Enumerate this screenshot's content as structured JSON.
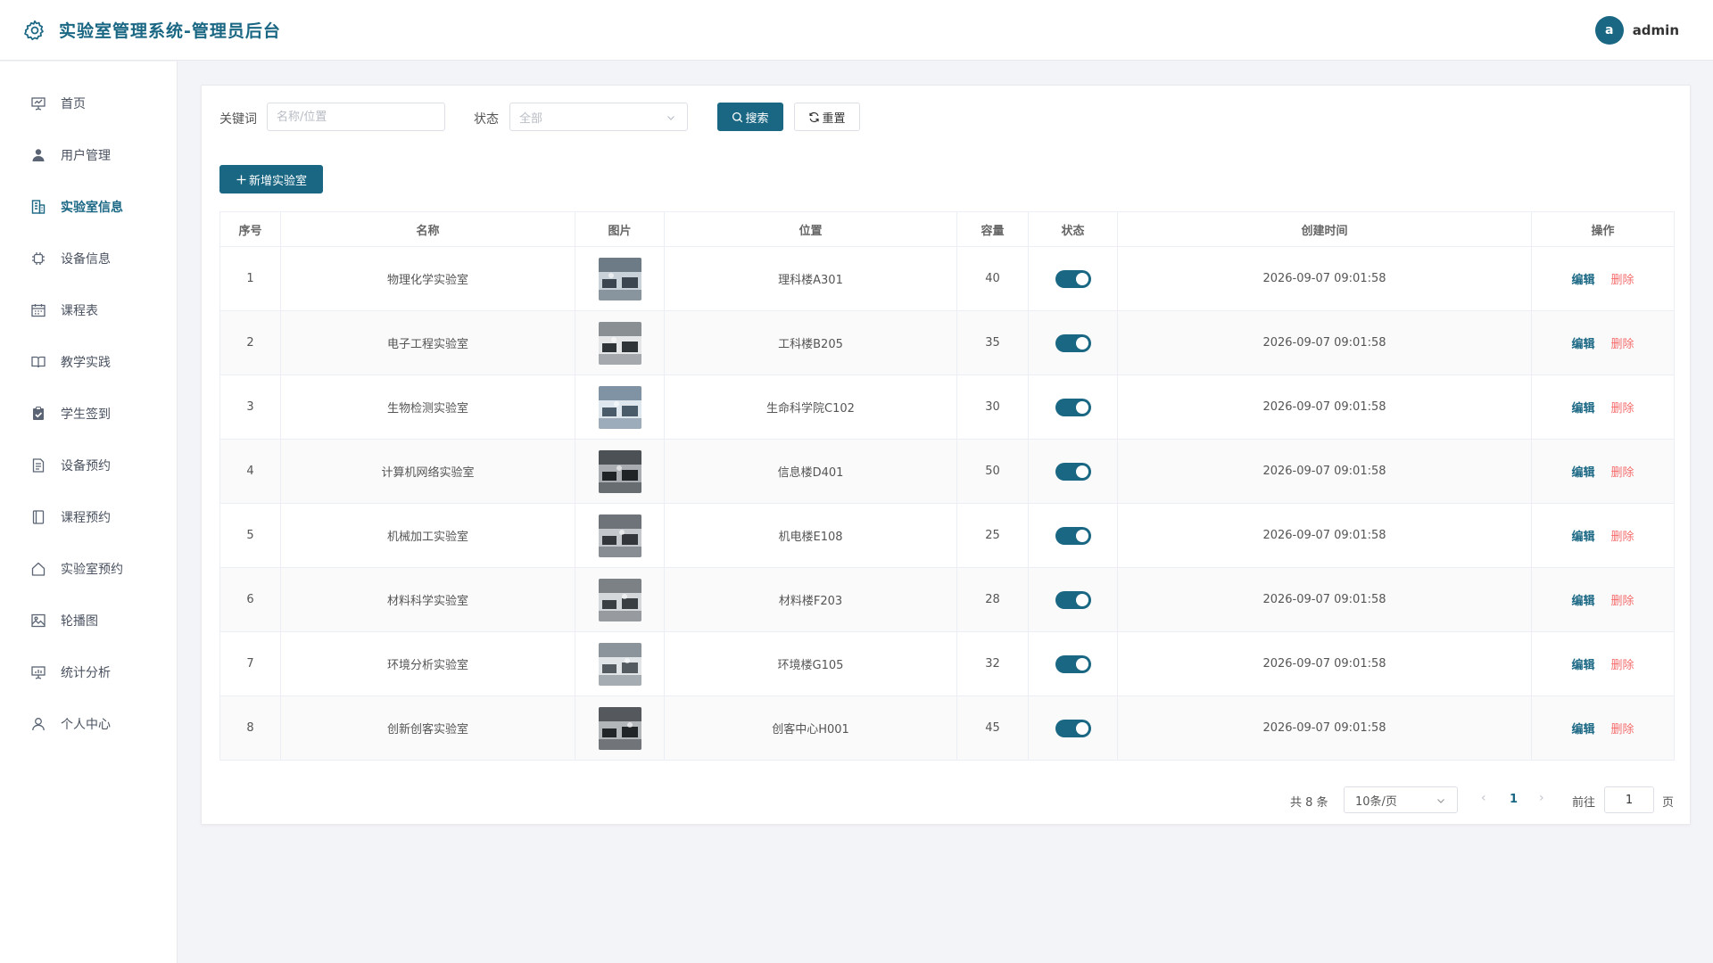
{
  "app": {
    "title": "实验室管理系统-管理员后台",
    "user": {
      "avatar_letter": "a",
      "name": "admin"
    }
  },
  "sidebar": {
    "items": [
      {
        "label": "首页",
        "icon": "presentation-icon"
      },
      {
        "label": "用户管理",
        "icon": "user-icon"
      },
      {
        "label": "实验室信息",
        "icon": "building-icon",
        "active": true
      },
      {
        "label": "设备信息",
        "icon": "chip-icon"
      },
      {
        "label": "课程表",
        "icon": "calendar-icon"
      },
      {
        "label": "教学实践",
        "icon": "book-open-icon"
      },
      {
        "label": "学生签到",
        "icon": "clipboard-check-icon"
      },
      {
        "label": "设备预约",
        "icon": "document-icon"
      },
      {
        "label": "课程预约",
        "icon": "notebook-icon"
      },
      {
        "label": "实验室预约",
        "icon": "home-icon"
      },
      {
        "label": "轮播图",
        "icon": "image-icon"
      },
      {
        "label": "统计分析",
        "icon": "chart-board-icon"
      },
      {
        "label": "个人中心",
        "icon": "person-icon"
      }
    ]
  },
  "filters": {
    "keyword_label": "关键词",
    "keyword_placeholder": "名称/位置",
    "status_label": "状态",
    "status_placeholder": "全部",
    "search_label": "搜索",
    "reset_label": "重置",
    "add_label": "新增实验室"
  },
  "table": {
    "headers": [
      "序号",
      "名称",
      "图片",
      "位置",
      "容量",
      "状态",
      "创建时间",
      "操作"
    ],
    "edit_label": "编辑",
    "delete_label": "删除",
    "rows": [
      {
        "index": "1",
        "name": "物理化学实验室",
        "location": "理科楼A301",
        "capacity": "40",
        "enabled": true,
        "created": "2026-09-07 09:01:58"
      },
      {
        "index": "2",
        "name": "电子工程实验室",
        "location": "工科楼B205",
        "capacity": "35",
        "enabled": true,
        "created": "2026-09-07 09:01:58"
      },
      {
        "index": "3",
        "name": "生物检测实验室",
        "location": "生命科学院C102",
        "capacity": "30",
        "enabled": true,
        "created": "2026-09-07 09:01:58"
      },
      {
        "index": "4",
        "name": "计算机网络实验室",
        "location": "信息楼D401",
        "capacity": "50",
        "enabled": true,
        "created": "2026-09-07 09:01:58"
      },
      {
        "index": "5",
        "name": "机械加工实验室",
        "location": "机电楼E108",
        "capacity": "25",
        "enabled": true,
        "created": "2026-09-07 09:01:58"
      },
      {
        "index": "6",
        "name": "材料科学实验室",
        "location": "材料楼F203",
        "capacity": "28",
        "enabled": true,
        "created": "2026-09-07 09:01:58"
      },
      {
        "index": "7",
        "name": "环境分析实验室",
        "location": "环境楼G105",
        "capacity": "32",
        "enabled": true,
        "created": "2026-09-07 09:01:58"
      },
      {
        "index": "8",
        "name": "创新创客实验室",
        "location": "创客中心H001",
        "capacity": "45",
        "enabled": true,
        "created": "2026-09-07 09:01:58"
      }
    ]
  },
  "pagination": {
    "total_text": "共 8 条",
    "page_size": "10条/页",
    "current_page": "1",
    "goto_label": "前往",
    "goto_value": "1",
    "page_suffix": "页"
  },
  "colors": {
    "primary": "#1a6784",
    "danger": "#f56c6c"
  }
}
